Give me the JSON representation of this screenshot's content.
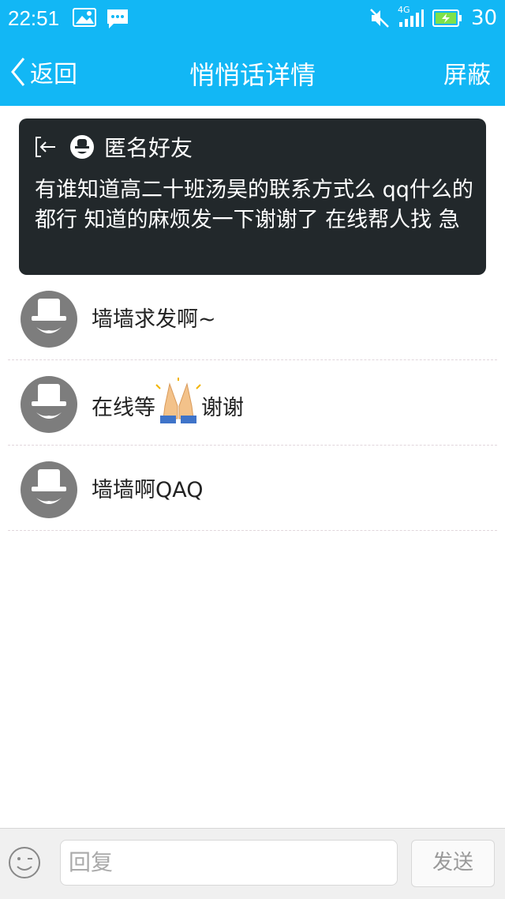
{
  "status_bar": {
    "time": "22:51",
    "network": "4G",
    "battery": "30",
    "icons": [
      "image-icon",
      "message-icon",
      "mute-icon",
      "signal-icon",
      "battery-icon"
    ]
  },
  "nav": {
    "back_label": "返回",
    "title": "悄悄话详情",
    "right_label": "屏蔽"
  },
  "post": {
    "user": "匿名好友",
    "text": "有谁知道高二十班汤昊的联系方式么 qq什么的都行 知道的麻烦发一下谢谢了 在线帮人找 急"
  },
  "replies": [
    {
      "text": "墙墙求发啊~"
    },
    {
      "text_before": "在线等 ",
      "text_after": "谢谢",
      "emoji": "folded-hands-icon"
    },
    {
      "text": "墙墙啊QAQ"
    }
  ],
  "bottom": {
    "input_placeholder": "回复",
    "send_label": "发送"
  },
  "colors": {
    "accent": "#12b7f5",
    "post_bg": "#22282b"
  }
}
